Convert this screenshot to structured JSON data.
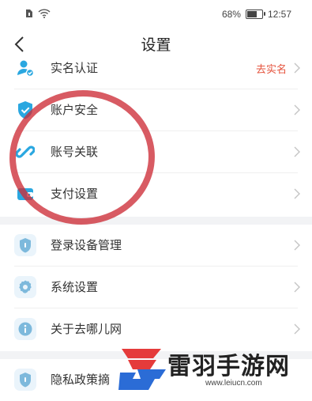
{
  "statusbar": {
    "battery": "68%",
    "time": "12:57",
    "battery_level": 0.68
  },
  "nav": {
    "title": "设置"
  },
  "groups": [
    {
      "items": [
        {
          "label": "实名认证",
          "extra": "去实名",
          "icon": "id-person-icon"
        },
        {
          "label": "账户安全",
          "icon": "shield-check-icon"
        },
        {
          "label": "账号关联",
          "icon": "link-icon"
        },
        {
          "label": "支付设置",
          "icon": "wallet-icon"
        }
      ]
    },
    {
      "items": [
        {
          "label": "登录设备管理",
          "icon": "shield-icon"
        },
        {
          "label": "系统设置",
          "icon": "gear-icon"
        },
        {
          "label": "关于去哪儿网",
          "icon": "info-icon"
        }
      ]
    },
    {
      "items": [
        {
          "label": "隐私政策摘",
          "icon": "shield-icon"
        }
      ]
    }
  ],
  "watermark": {
    "text": "雷羽手游网",
    "url": "www.leiucn.com"
  },
  "colors": {
    "accent": "#2aa7e0",
    "warn": "#e5533d",
    "annotation": "#cd2d37"
  }
}
